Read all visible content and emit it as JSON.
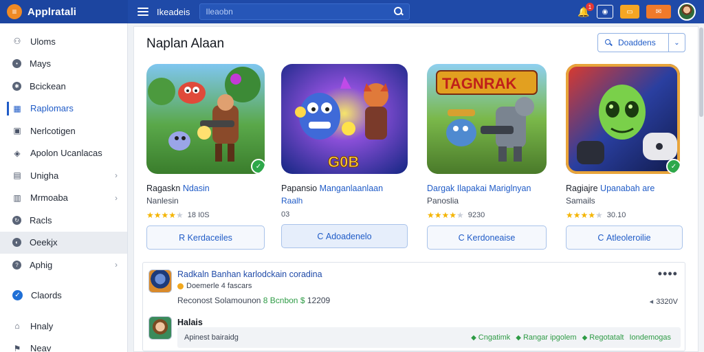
{
  "app": {
    "title": "Applratali",
    "nav_label": "Ikeadeis",
    "search_placeholder": "Ileaobn"
  },
  "topbar": {
    "notification_count": "1",
    "chip1": "",
    "chip2": "",
    "chip3": ""
  },
  "sidebar": {
    "items": [
      {
        "label": "Uloms",
        "icon": "users-icon"
      },
      {
        "label": "Mays",
        "icon": "map-pin-icon"
      },
      {
        "label": "Bcickean",
        "icon": "gear-icon"
      },
      {
        "label": "Raplomars",
        "icon": "grid-icon",
        "active": true
      },
      {
        "label": "Nerlcotigen",
        "icon": "image-icon"
      },
      {
        "label": "Apolon Ucanlacas",
        "icon": "pin-icon"
      },
      {
        "label": "Unigha",
        "icon": "book-icon",
        "chevron": true
      },
      {
        "label": "Mrmoaba",
        "icon": "chart-icon",
        "chevron": true
      },
      {
        "label": "Racls",
        "icon": "refresh-icon"
      },
      {
        "label": "Oeekjx",
        "icon": "shield-icon",
        "hover": true
      },
      {
        "label": "Aphig",
        "icon": "help-icon",
        "chevron": true
      },
      {
        "label": "Claords",
        "icon": "check-circle-icon"
      },
      {
        "label": "Hnaly",
        "icon": "home-icon"
      },
      {
        "label": "Neav",
        "icon": "flag-icon"
      }
    ]
  },
  "main": {
    "title": "Naplan Alaan",
    "downloads_label": "Doaddens",
    "cards": [
      {
        "title_a": "Ragaskn",
        "title_b": "Ndasin",
        "subtitle": "Nanlesin",
        "rating": 4,
        "rating_text": "18 I0S",
        "button": "Kerdaceiles",
        "button_icon": "R",
        "colors": [
          "#2f8a3a",
          "#f5b041"
        ]
      },
      {
        "title_a": "Papansio",
        "title_b": "Manganlaanlaan",
        "subtitle": "Raalh",
        "rating": 0,
        "rating_text": "03",
        "button": "Adoadenelo",
        "button_icon": "C",
        "colors": [
          "#3a2a8c",
          "#b03fd8"
        ]
      },
      {
        "title_a": "Dargak Ilapakai Mariglnyan",
        "title_b": "",
        "subtitle": "Panoslia",
        "rating": 4,
        "rating_text": "9230",
        "button": "Kerdoneaise",
        "button_icon": "C",
        "colors": [
          "#5a9a3a",
          "#f2c230"
        ]
      },
      {
        "title_a": "Ragiajre",
        "title_b": "Upanabah are",
        "subtitle": "Samails",
        "rating": 4,
        "rating_text": "30.10",
        "button": "Atleoleroilie",
        "button_icon": "C",
        "colors": [
          "#c8202a",
          "#1f3f9a"
        ]
      }
    ],
    "detail": {
      "title": "Radkaln Banhan karlodckain coradina",
      "meta": "Doemerle 4 fascars",
      "line3_a": "Reconost Solamounon",
      "line3_b": "8 Bcnbon",
      "line3_c": "12209",
      "size": "3320V",
      "section": "Halais",
      "bar_text": "Apinest bairaidg",
      "actions": [
        "Cngatimk",
        "Rangar ipgolem",
        "Regotatalt",
        "Iondemogas"
      ]
    }
  }
}
